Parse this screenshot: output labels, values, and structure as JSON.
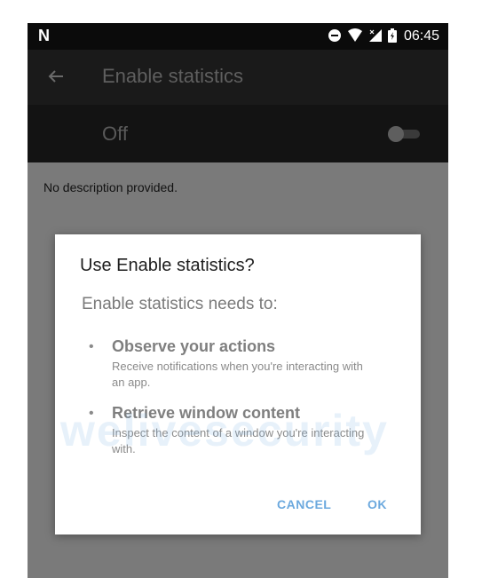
{
  "status_bar": {
    "left_glyph": "N",
    "icons": [
      "minus-circle-icon",
      "wifi-icon",
      "signal-icon",
      "battery-icon"
    ],
    "time": "06:45"
  },
  "toolbar": {
    "back_icon": "back-arrow-icon",
    "title": "Enable statistics"
  },
  "switch_bar": {
    "label": "Off",
    "checked": false
  },
  "description": "No description provided.",
  "dialog": {
    "title": "Use Enable statistics?",
    "subtitle": "Enable statistics needs to:",
    "permissions": [
      {
        "title": "Observe your actions",
        "description": "Receive notifications when you're interacting with an app."
      },
      {
        "title": "Retrieve window content",
        "description": "Inspect the content of a window you're interacting with."
      }
    ],
    "bullet": "•",
    "cancel_label": "CANCEL",
    "ok_label": "OK"
  },
  "watermark": "welivesecurity",
  "colors": {
    "accent": "#6ca9de",
    "status_bar": "#0b0b0b",
    "toolbar": "#1a1a1a",
    "scrim": "#7a7a7a"
  }
}
